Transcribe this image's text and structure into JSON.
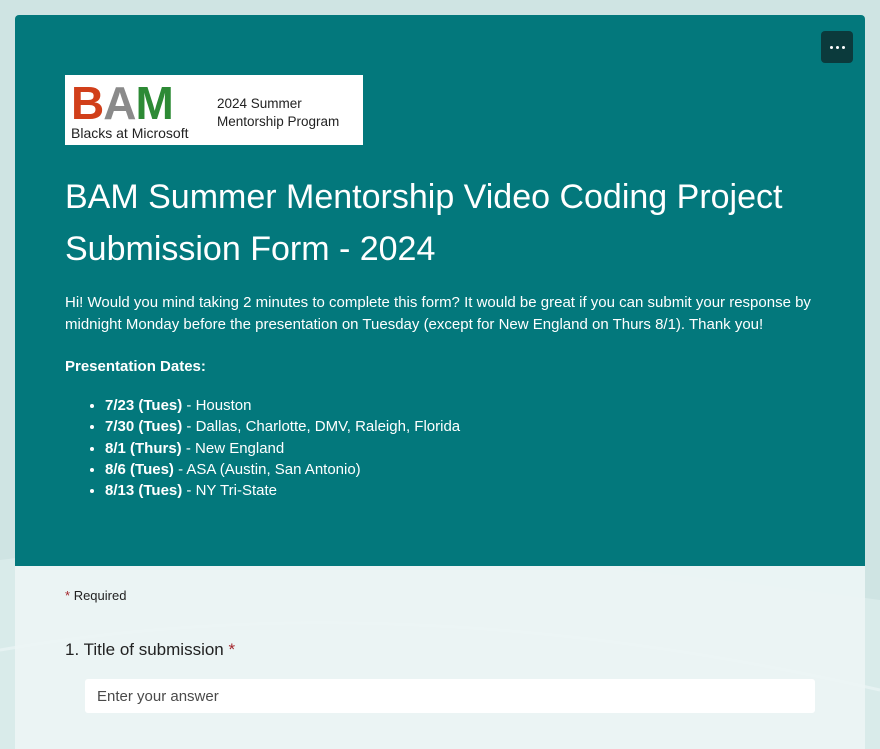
{
  "header": {
    "more_options_icon": "ellipsis-icon",
    "logo": {
      "letters": [
        "B",
        "A",
        "M"
      ],
      "subtitle": "Blacks at Microsoft",
      "program_line1": "2024 Summer",
      "program_line2": "Mentorship Program"
    },
    "title": "BAM Summer Mentorship Video Coding Project Submission Form - 2024",
    "description": "Hi! Would you mind taking 2 minutes to complete this form? It would be great if you can submit your response by midnight Monday before the presentation on Tuesday (except for New England on Thurs 8/1). Thank you!",
    "dates_heading": "Presentation Dates:",
    "dates": [
      {
        "date": "7/23 (Tues)",
        "location": " - Houston"
      },
      {
        "date": "7/30 (Tues)",
        "location": " - Dallas, Charlotte, DMV, Raleigh, Florida"
      },
      {
        "date": "8/1 (Thurs)",
        "location": " - New England"
      },
      {
        "date": "8/6 (Tues)",
        "location": " - ASA (Austin, San Antonio)"
      },
      {
        "date": "8/13 (Tues)",
        "location": " - NY Tri-State"
      }
    ]
  },
  "form": {
    "required_star": "*",
    "required_label": "Required",
    "question_1": {
      "number": "1.",
      "label": "Title of submission",
      "star": "*",
      "placeholder": "Enter your answer"
    }
  },
  "colors": {
    "header_bg": "#03787c",
    "page_bg": "#cfe4e3",
    "required_star": "#a4262c"
  }
}
